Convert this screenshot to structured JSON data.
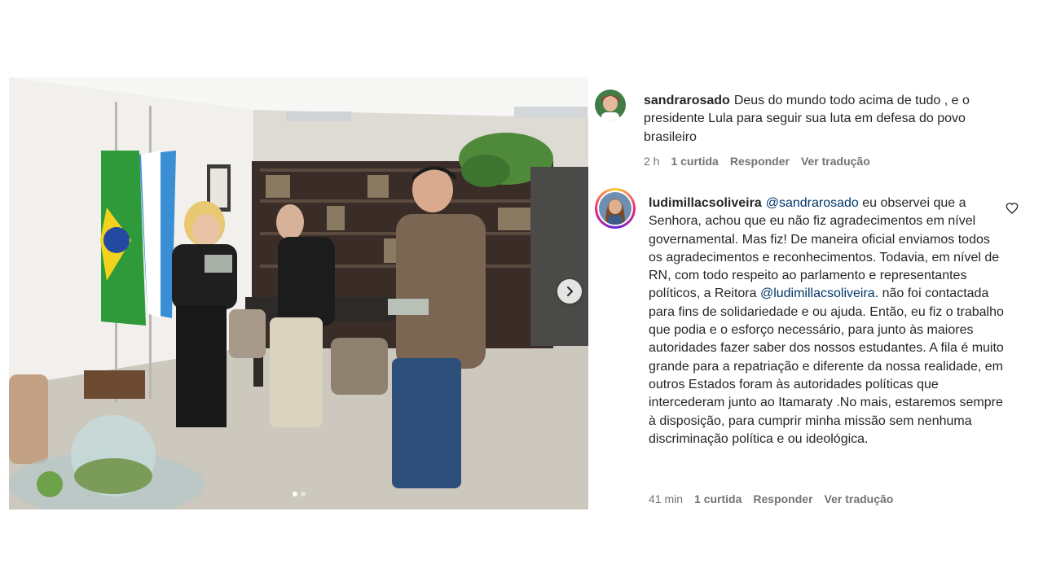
{
  "post": {
    "carousel": {
      "total_slides": 2,
      "active_slide": 1
    }
  },
  "comments": [
    {
      "username": "sandrarosado",
      "text": "Deus do mundo todo acima de tudo , e o presidente Lula para seguir sua luta em defesa do povo brasileiro",
      "time": "2 h",
      "likes": "1 curtida",
      "reply": "Responder",
      "translate": "Ver tradução"
    },
    {
      "username": "ludimillacsoliveira",
      "mention_1": "@sandrarosado",
      "text_1": " eu observei que a Senhora, achou que eu não fiz agradecimentos em nível governamental. Mas fiz! De maneira oficial enviamos todos os agradecimentos e reconhecimentos. Todavia, em nível de RN, com todo respeito ao parlamento e representantes políticos, a Reitora ",
      "mention_2": "@ludimillacsoliveira",
      "text_2": ". não foi contactada para fins de solidariedade e ou ajuda. Então, eu fiz o trabalho que podia e o esforço necessário, para junto às maiores autoridades fazer saber dos nossos estudantes. A fila é muito grande para a repatriação e diferente da nossa realidade, em outros Estados foram às autoridades políticas que intercederam junto ao Itamaraty .No mais, estaremos sempre à disposição, para cumprir minha missão sem nenhuma discriminação política e ou ideológica.",
      "time": "41 min",
      "likes": "1 curtida",
      "reply": "Responder",
      "translate": "Ver tradução"
    }
  ],
  "icons": {
    "next": "chevron-right-icon",
    "like": "heart-outline-icon"
  },
  "colors": {
    "text": "#262626",
    "secondary": "#737373",
    "mention": "#00376b"
  }
}
